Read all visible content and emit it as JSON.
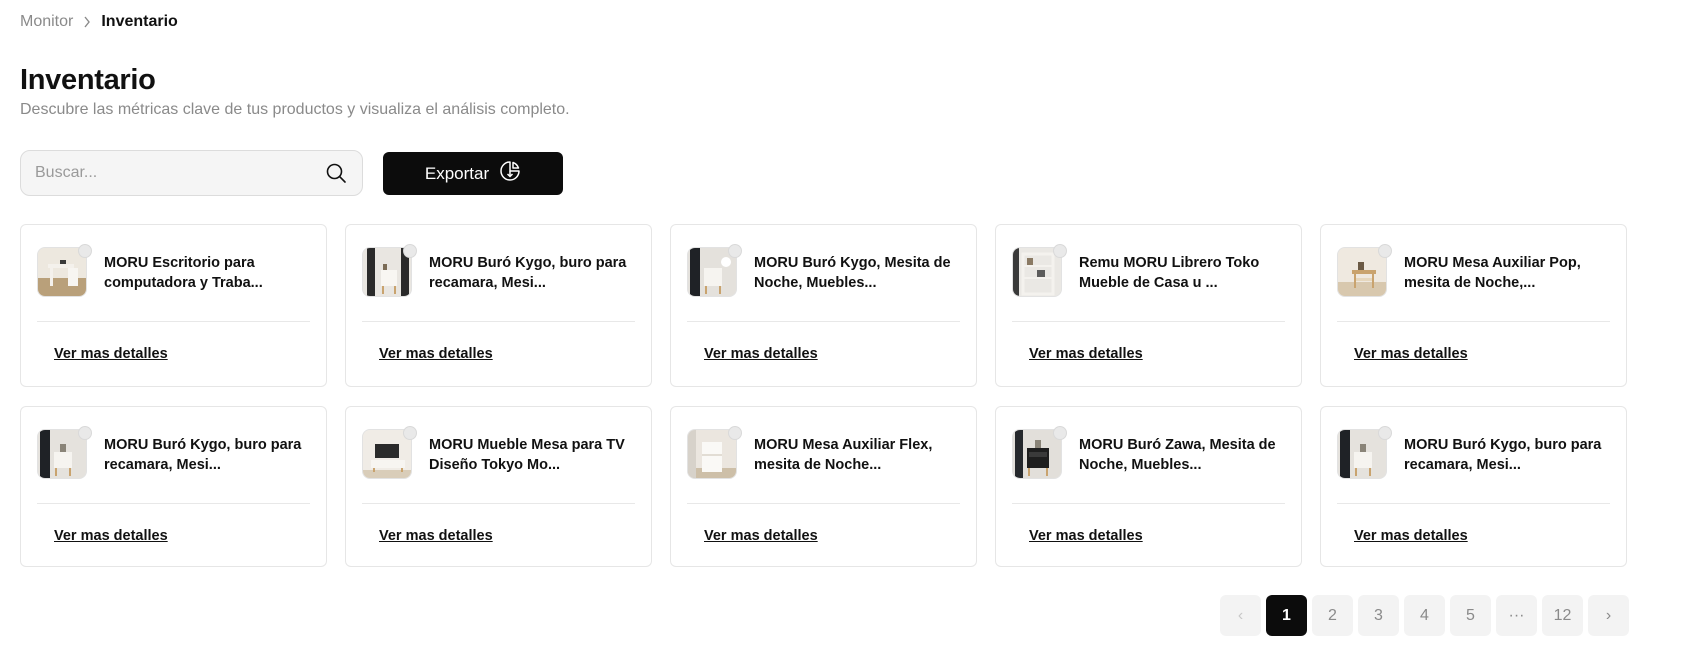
{
  "breadcrumb": {
    "parent": "Monitor",
    "current": "Inventario"
  },
  "header": {
    "title": "Inventario",
    "subtitle": "Descubre las métricas clave de tus productos y visualiza el análisis completo."
  },
  "search": {
    "placeholder": "Buscar...",
    "value": ""
  },
  "export": {
    "label": "Exportar"
  },
  "colors": {
    "primary": "#0c0c0c",
    "muted": "#8a8a8a",
    "border": "#e6e6e6"
  },
  "products": [
    {
      "name": "MORU Escritorio para computadora y Traba...",
      "link": "Ver mas detalles"
    },
    {
      "name": "MORU Buró Kygo, buro para recamara, Mesi...",
      "link": "Ver mas detalles"
    },
    {
      "name": "MORU Buró Kygo, Mesita de Noche, Muebles...",
      "link": "Ver mas detalles"
    },
    {
      "name": "Remu MORU Librero Toko Mueble de Casa u ...",
      "link": "Ver mas detalles"
    },
    {
      "name": "MORU Mesa Auxiliar Pop, mesita de Noche,...",
      "link": "Ver mas detalles"
    },
    {
      "name": "MORU Buró Kygo, buro para recamara, Mesi...",
      "link": "Ver mas detalles"
    },
    {
      "name": "MORU Mueble Mesa para TV Diseño Tokyo Mo...",
      "link": "Ver mas detalles"
    },
    {
      "name": "MORU Mesa Auxiliar Flex, mesita de Noche...",
      "link": "Ver mas detalles"
    },
    {
      "name": "MORU Buró Zawa, Mesita de Noche, Muebles...",
      "link": "Ver mas detalles"
    },
    {
      "name": "MORU Buró Kygo, buro para recamara, Mesi...",
      "link": "Ver mas detalles"
    }
  ],
  "pagination": {
    "prev": "‹",
    "pages": [
      "1",
      "2",
      "3",
      "4",
      "5",
      "···",
      "12"
    ],
    "next": "›",
    "current": "1"
  }
}
